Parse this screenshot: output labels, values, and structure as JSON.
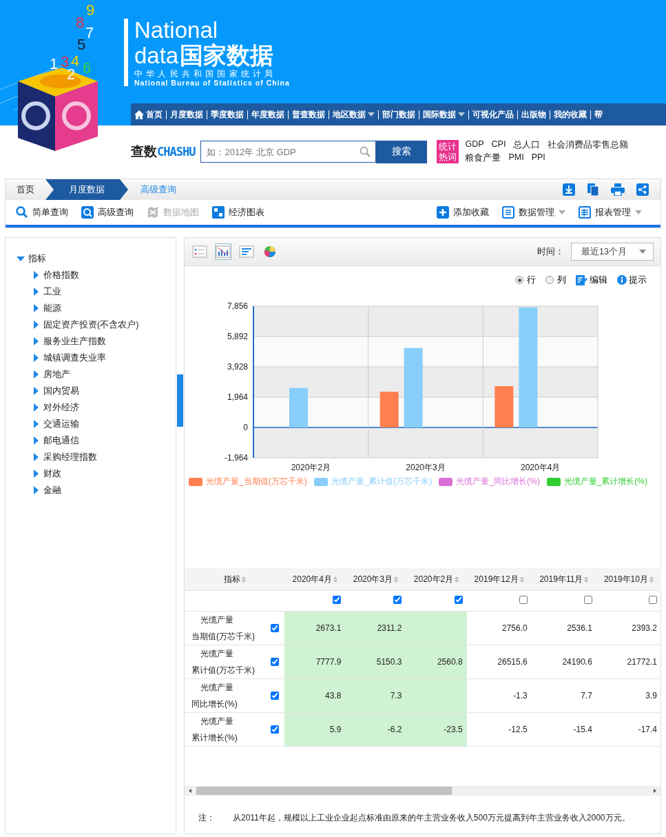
{
  "header": {
    "logo_digits": [
      "8",
      "9",
      "7",
      "5",
      "1",
      "3",
      "4",
      "2",
      "6"
    ],
    "title_en": "National",
    "title_line2_en": "data",
    "title_cn": "国家数据",
    "org_cn": "中华人民共和国国家统计局",
    "org_en": "National Bureau of Statistics of China"
  },
  "nav": [
    {
      "label": "首页",
      "kind": "home",
      "has_menu": false
    },
    {
      "label": "月度数据",
      "kind": "link",
      "has_menu": false
    },
    {
      "label": "季度数据",
      "kind": "link",
      "has_menu": false
    },
    {
      "label": "年度数据",
      "kind": "link",
      "has_menu": false
    },
    {
      "label": "普查数据",
      "kind": "link",
      "has_menu": false
    },
    {
      "label": "地区数据",
      "kind": "link",
      "has_menu": true
    },
    {
      "label": "部门数据",
      "kind": "link",
      "has_menu": false
    },
    {
      "label": "国际数据",
      "kind": "link",
      "has_menu": true
    },
    {
      "label": "可视化产品",
      "kind": "link",
      "has_menu": false
    },
    {
      "label": "出版物",
      "kind": "link",
      "has_menu": false
    },
    {
      "label": "我的收藏",
      "kind": "link",
      "has_menu": false
    },
    {
      "label": "帮",
      "kind": "link",
      "has_menu": false
    }
  ],
  "search": {
    "brand_cn": "查数",
    "brand_en": "CHASHU",
    "placeholder": "如：2012年 北京 GDP",
    "button": "搜索",
    "hot_badge": [
      "统计",
      "热词"
    ],
    "hot_words": [
      [
        "GDP",
        "CPI",
        "总人口",
        "社会消费品零售总额"
      ],
      [
        "粮食产量",
        "PMI",
        "PPI"
      ]
    ]
  },
  "breadcrumb": [
    {
      "label": "首页",
      "selected": false
    },
    {
      "label": "月度数据",
      "selected": true
    },
    {
      "label": "高级查询",
      "selected": false
    }
  ],
  "toolbar": {
    "left": [
      {
        "label": "简单查询",
        "kind": "search",
        "disabled": false
      },
      {
        "label": "高级查询",
        "kind": "advanced",
        "disabled": false
      },
      {
        "label": "数据地图",
        "kind": "map",
        "disabled": true
      },
      {
        "label": "经济图表",
        "kind": "chart",
        "disabled": false
      }
    ],
    "right": [
      {
        "label": "添加收藏",
        "kind": "add",
        "has_menu": false
      },
      {
        "label": "数据管理",
        "kind": "list",
        "has_menu": true
      },
      {
        "label": "报表管理",
        "kind": "grid",
        "has_menu": true
      }
    ]
  },
  "tree": {
    "label": "指标",
    "expanded": true,
    "children": [
      {
        "label": "价格指数",
        "expanded": false
      },
      {
        "label": "工业",
        "expanded": false
      },
      {
        "label": "能源",
        "expanded": false
      },
      {
        "label": "固定资产投资(不含农户)",
        "expanded": false
      },
      {
        "label": "服务业生产指数",
        "expanded": false
      },
      {
        "label": "城镇调查失业率",
        "expanded": false
      },
      {
        "label": "房地产",
        "expanded": false
      },
      {
        "label": "国内贸易",
        "expanded": false
      },
      {
        "label": "对外经济",
        "expanded": false
      },
      {
        "label": "交通运输",
        "expanded": false
      },
      {
        "label": "邮电通信",
        "expanded": false
      },
      {
        "label": "采购经理指数",
        "expanded": false
      },
      {
        "label": "财政",
        "expanded": false
      },
      {
        "label": "金融",
        "expanded": false
      }
    ]
  },
  "view_tabs": [
    {
      "kind": "table",
      "selected": false
    },
    {
      "kind": "bar",
      "selected": true
    },
    {
      "kind": "hbar",
      "selected": false
    },
    {
      "kind": "pie",
      "selected": false
    }
  ],
  "time": {
    "label": "时间：",
    "value": "最近13个月"
  },
  "options": {
    "orientation": [
      {
        "label": "行",
        "selected": true
      },
      {
        "label": "列",
        "selected": false
      }
    ],
    "edit": "编辑",
    "hint": "提示"
  },
  "chart_data": {
    "type": "bar",
    "grid": true,
    "ref_lines": [
      {
        "axis": "y",
        "value": 0
      }
    ],
    "categories": [
      "2020年2月",
      "2020年3月",
      "2020年4月"
    ],
    "ylim": [
      -1964,
      7856
    ],
    "yticks": [
      {
        "value": -1964,
        "label": "-1,964"
      },
      0,
      {
        "value": 1964,
        "label": "1,964"
      },
      {
        "value": 3928,
        "label": "3,928"
      },
      {
        "value": 5892,
        "label": "5,892"
      },
      {
        "value": 7856,
        "label": "7,856"
      }
    ],
    "series": [
      {
        "name": "光缆产量_当期值(万芯千米)",
        "color": "#ff7f50",
        "values": [
          null,
          2311.2,
          2673.1
        ]
      },
      {
        "name": "光缆产量_累计值(万芯千米)",
        "color": "#87cefa",
        "values": [
          2560.8,
          5150.3,
          7777.9
        ]
      },
      {
        "name": "光缆产量_同比增长(%)",
        "color": "#da70d6",
        "values": [
          null,
          7.3,
          43.8
        ]
      },
      {
        "name": "光缆产量_累计增长(%)",
        "color": "#32cd32",
        "values": [
          -23.5,
          -6.2,
          5.9
        ]
      }
    ]
  },
  "table": {
    "first_column": "指标",
    "columns": [
      {
        "label": "2020年4月",
        "checked": true
      },
      {
        "label": "2020年3月",
        "checked": true
      },
      {
        "label": "2020年2月",
        "checked": true
      },
      {
        "label": "2019年12月",
        "checked": false
      },
      {
        "label": "2019年11月",
        "checked": false
      },
      {
        "label": "2019年10月",
        "checked": false
      }
    ],
    "rows": [
      {
        "indicator": "光缆产量",
        "measure": "当期值(万芯千米)",
        "checked": true,
        "values": [
          {
            "value": "2673.1"
          },
          {
            "value": "2311.2"
          },
          {
            "blank": true
          },
          {
            "value": "2756.0"
          },
          {
            "value": "2536.1"
          },
          {
            "value": "2393.2"
          }
        ]
      },
      {
        "indicator": "光缆产量",
        "measure": "累计值(万芯千米)",
        "checked": true,
        "values": [
          {
            "value": "7777.9"
          },
          {
            "value": "5150.3"
          },
          {
            "value": "2560.8"
          },
          {
            "value": "26515.6"
          },
          {
            "value": "24190.6"
          },
          {
            "value": "21772.1"
          }
        ]
      },
      {
        "indicator": "光缆产量",
        "measure": "同比增长(%)",
        "checked": true,
        "values": [
          {
            "value": "43.8"
          },
          {
            "value": "7.3"
          },
          {
            "blank": true
          },
          {
            "value": "-1.3"
          },
          {
            "value": "7.7"
          },
          {
            "value": "3.9"
          }
        ]
      },
      {
        "indicator": "光缆产量",
        "measure": "累计增长(%)",
        "checked": true,
        "values": [
          {
            "value": "5.9"
          },
          {
            "value": "-6.2"
          },
          {
            "value": "-23.5"
          },
          {
            "value": "-12.5"
          },
          {
            "value": "-15.4"
          },
          {
            "value": "-17.4"
          }
        ]
      }
    ]
  },
  "note": {
    "label": "注：",
    "text": "从2011年起，规模以上工业企业起点标准由原来的年主营业务收入500万元提高到年主营业务收入2000万元。"
  }
}
